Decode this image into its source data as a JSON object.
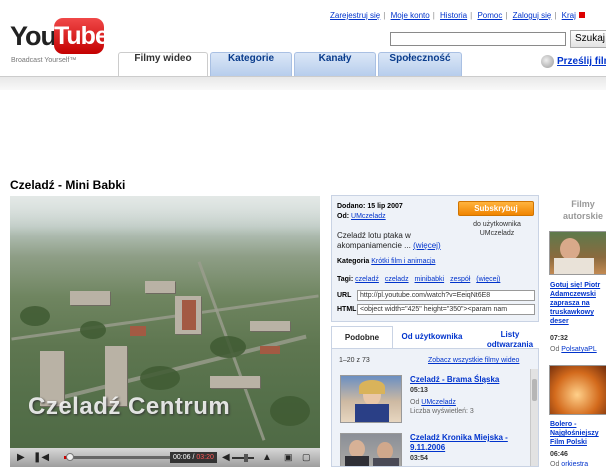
{
  "brand": {
    "you": "You",
    "tube": "Tube",
    "tagline": "Broadcast Yourself™"
  },
  "top_links": [
    "Zarejestruj się",
    "Moje konto",
    "Historia",
    "Pomoc",
    "Zaloguj się",
    "Kraj"
  ],
  "search": {
    "value": "",
    "button_label": "Szukaj"
  },
  "nav_tabs": [
    "Filmy wideo",
    "Kategorie",
    "Kanały",
    "Społeczność"
  ],
  "upload_label": "Prześlij filmy",
  "video": {
    "title": "Czeladź - Mini Babki",
    "watermark": "Czeladź Centrum",
    "time_current": "00:06",
    "time_total": "03:20",
    "progress": 0.03
  },
  "info": {
    "added_label": "Dodano:",
    "added_date": "15 lip 2007",
    "from_label": "Od:",
    "author": "UMczeladz",
    "subscribe_label": "Subskrybuj",
    "subscribe_note": "do użytkownika UMczeladz",
    "description": "Czeladź lotu ptaka w akompaniamencie ...",
    "more_label": "(więcej)",
    "category_label": "Kategoria",
    "category": "Krótki film i animacja",
    "tags_label": "Tagi:",
    "tags": [
      "czeladź",
      "czeladz",
      "minibabki",
      "zespół",
      "(więcej)"
    ],
    "url_label": "URL",
    "url_value": "http://pl.youtube.com/watch?v=EeiqNt6E8",
    "html_label": "HTML",
    "html_value": "<object width=\"425\" height=\"350\"><param nam"
  },
  "related": {
    "tabs": [
      "Podobne",
      "Od użytkownika",
      "Listy odtwarzania"
    ],
    "count": "1–20 z 73",
    "see_all": "Zobacz wszystkie filmy wideo",
    "items": [
      {
        "title": "Czeladź - Brama Śląska",
        "duration": "05:13",
        "from_label": "Od",
        "author": "UMczeladz",
        "views": "Liczba wyświetleń: 3"
      },
      {
        "title": "Czeladź Kronika Miejska - 9.11.2006",
        "duration": "03:54"
      }
    ]
  },
  "side": {
    "heading": "Filmy autorskie",
    "items": [
      {
        "title": "Gotuj się! Piotr Adamczewski zaprasza na truskawkowy deser",
        "duration": "07:32",
        "from_label": "Od",
        "author": "PolsatyaPL"
      },
      {
        "title": "Bolero - Najgłośniejszy Film Polski",
        "duration": "06:46",
        "from_label": "Od",
        "author": "orkiestra"
      }
    ]
  },
  "colors": {
    "brand_red": "#d40000",
    "link": "#0033cc",
    "subscribe": "#f08400",
    "tab_blue": "#b7cdec"
  }
}
